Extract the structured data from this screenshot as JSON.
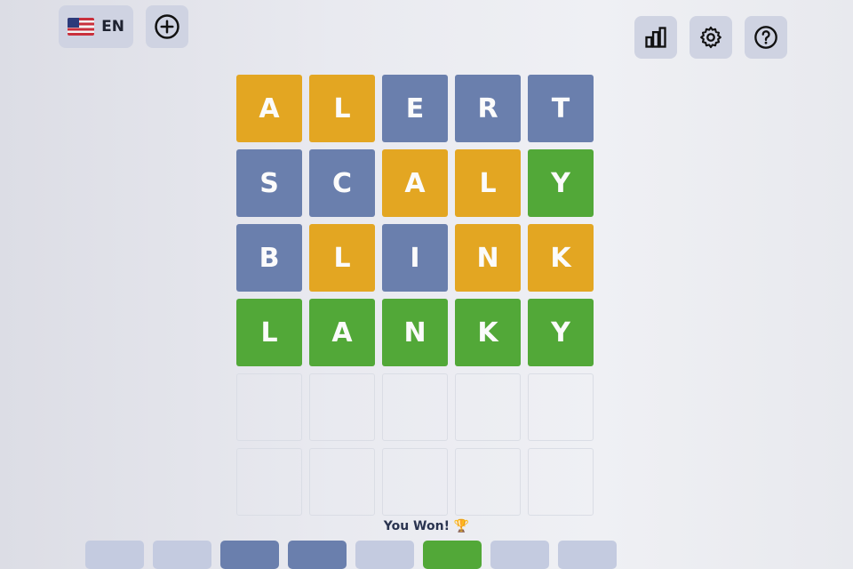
{
  "header": {
    "language": "EN",
    "icons": {
      "add": "plus-circle-icon",
      "stats": "bar-chart-icon",
      "settings": "gear-icon",
      "help": "question-circle-icon"
    }
  },
  "board": {
    "colors": {
      "correct": "#52a838",
      "present": "#e3a622",
      "absent": "#6a7fad"
    },
    "rows": [
      [
        {
          "letter": "A",
          "state": "present"
        },
        {
          "letter": "L",
          "state": "present"
        },
        {
          "letter": "E",
          "state": "absent"
        },
        {
          "letter": "R",
          "state": "absent"
        },
        {
          "letter": "T",
          "state": "absent"
        }
      ],
      [
        {
          "letter": "S",
          "state": "absent"
        },
        {
          "letter": "C",
          "state": "absent"
        },
        {
          "letter": "A",
          "state": "present"
        },
        {
          "letter": "L",
          "state": "present"
        },
        {
          "letter": "Y",
          "state": "correct"
        }
      ],
      [
        {
          "letter": "B",
          "state": "absent"
        },
        {
          "letter": "L",
          "state": "present"
        },
        {
          "letter": "I",
          "state": "absent"
        },
        {
          "letter": "N",
          "state": "present"
        },
        {
          "letter": "K",
          "state": "present"
        }
      ],
      [
        {
          "letter": "L",
          "state": "correct"
        },
        {
          "letter": "A",
          "state": "correct"
        },
        {
          "letter": "N",
          "state": "correct"
        },
        {
          "letter": "K",
          "state": "correct"
        },
        {
          "letter": "Y",
          "state": "correct"
        }
      ],
      [
        {
          "letter": "",
          "state": "empty"
        },
        {
          "letter": "",
          "state": "empty"
        },
        {
          "letter": "",
          "state": "empty"
        },
        {
          "letter": "",
          "state": "empty"
        },
        {
          "letter": "",
          "state": "empty"
        }
      ],
      [
        {
          "letter": "",
          "state": "empty"
        },
        {
          "letter": "",
          "state": "empty"
        },
        {
          "letter": "",
          "state": "empty"
        },
        {
          "letter": "",
          "state": "empty"
        },
        {
          "letter": "",
          "state": "empty"
        }
      ]
    ]
  },
  "status": {
    "message": "You Won! 🏆"
  }
}
